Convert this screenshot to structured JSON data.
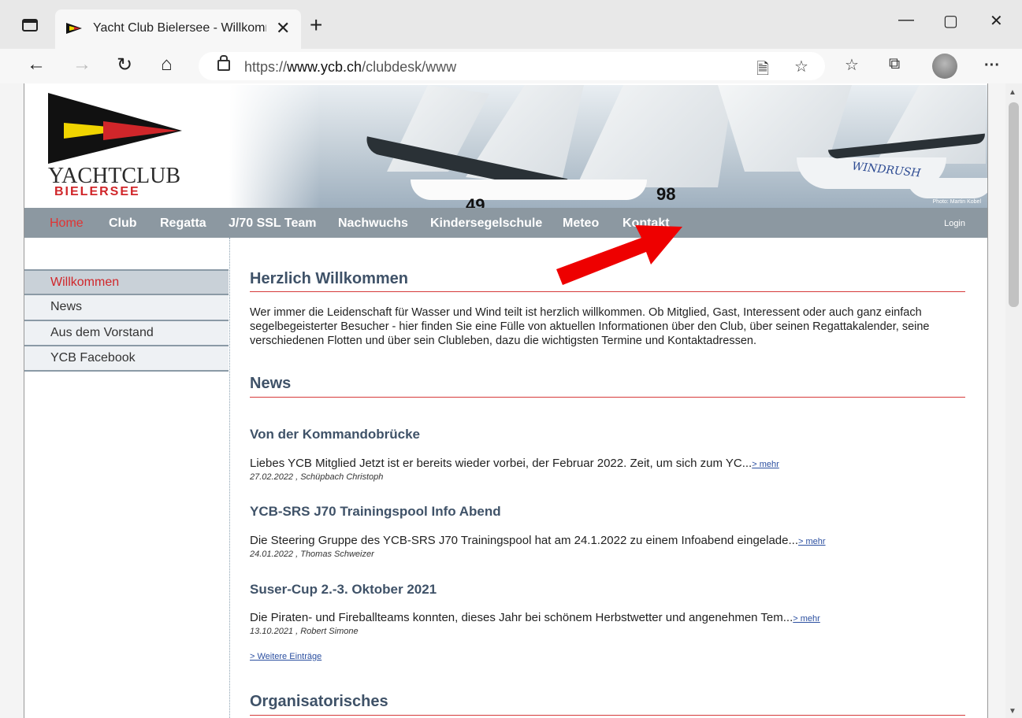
{
  "browser": {
    "tab_title": "Yacht Club Bielersee - Willkommen",
    "tab_close": "✕",
    "new_tab": "+",
    "minimize": "—",
    "maximize": "▢",
    "close": "✕",
    "url_prefix": "https://",
    "url_domain": "www.ycb.ch",
    "url_path": "/clubdesk/www",
    "icons": {
      "back": "←",
      "forward": "→",
      "reload": "↻",
      "home": "⌂",
      "read_aloud": "🗎",
      "add_favorite": "☆",
      "favorites": "☆",
      "collections": "⧉",
      "more": "···"
    }
  },
  "site": {
    "logo_name": "YACHTCLUB",
    "logo_sub": "BIELERSEE",
    "hero_boatname": "WINDRUSH",
    "hero_sailnum_1": "49",
    "hero_sailnum_2": "98",
    "hero_credit": "Photo: Martin Kobel",
    "colors": {
      "menu_bg": "#8c98a1",
      "accent_red": "#d0262a",
      "heading": "#3f5268"
    },
    "menu": [
      {
        "label": "Home"
      },
      {
        "label": "Club"
      },
      {
        "label": "Regatta"
      },
      {
        "label": "J/70 SSL Team"
      },
      {
        "label": "Nachwuchs"
      },
      {
        "label": "Kindersegelschule"
      },
      {
        "label": "Meteo"
      },
      {
        "label": "Kontakt"
      }
    ],
    "login": "Login",
    "sidebar": [
      {
        "label": "Willkommen"
      },
      {
        "label": "News"
      },
      {
        "label": "Aus dem Vorstand"
      },
      {
        "label": "YCB Facebook"
      }
    ]
  },
  "content": {
    "welcome_heading": "Herzlich Willkommen",
    "welcome_text": "Wer immer die Leidenschaft für Wasser und Wind teilt ist herzlich willkommen. Ob Mitglied, Gast, Interessent oder auch ganz einfach segelbegeisterter Besucher - hier finden Sie eine Fülle von aktuellen Informationen über den Club, über seinen Regattakalender, seine verschiedenen Flotten und über sein Clubleben, dazu die wichtigsten Termine und Kontaktadressen.",
    "news_heading": "News",
    "news": [
      {
        "title": "Von der Kommandobrücke",
        "text": "Liebes YCB Mitglied Jetzt ist er bereits wieder vorbei, der Februar 2022. Zeit, um sich zum YC...",
        "more": "> mehr",
        "meta": "27.02.2022 , Schüpbach Christoph"
      },
      {
        "title": "YCB-SRS J70 Trainingspool Info Abend",
        "text": "Die Steering Gruppe des YCB-SRS J70 Trainingspool hat am 24.1.2022 zu einem Infoabend eingelade...",
        "more": "> mehr",
        "meta": "24.01.2022 , Thomas Schweizer"
      },
      {
        "title": "Suser-Cup 2.-3. Oktober 2021",
        "text": "Die Piraten- und Fireballteams konnten, dieses Jahr bei schönem Herbstwetter und angenehmen Tem...",
        "more": "> mehr",
        "meta": "13.10.2021 , Robert Simone"
      }
    ],
    "more_entries": "> Weitere Einträge",
    "org_heading": "Organisatorisches"
  }
}
